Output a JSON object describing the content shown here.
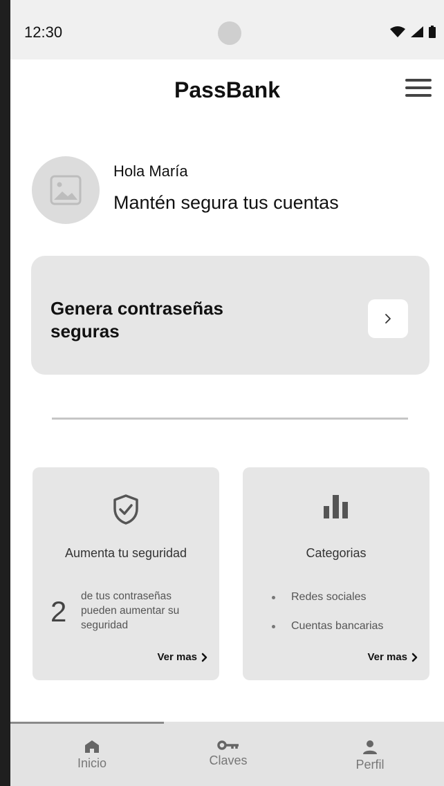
{
  "status": {
    "time": "12:30"
  },
  "app": {
    "title": "PassBank"
  },
  "profile": {
    "greeting": "Hola María",
    "tagline": "Mantén segura tus cuentas"
  },
  "generator": {
    "title": "Genera contraseñas seguras"
  },
  "security_card": {
    "title": "Aumenta tu seguridad",
    "count": "2",
    "description": "de tus contraseñas pueden aumentar su seguridad",
    "link": "Ver mas"
  },
  "categories_card": {
    "title": "Categorias",
    "items": [
      "Redes sociales",
      "Cuentas bancarias"
    ],
    "link": "Ver mas"
  },
  "nav": {
    "home": "Inicio",
    "keys": "Claves",
    "profile": "Perfil"
  },
  "icons": [
    "wifi-icon",
    "signal-icon",
    "battery-icon",
    "menu-icon",
    "image-placeholder-icon",
    "chevron-right-icon",
    "shield-check-icon",
    "bar-chart-icon",
    "home-icon",
    "key-icon",
    "person-icon"
  ]
}
